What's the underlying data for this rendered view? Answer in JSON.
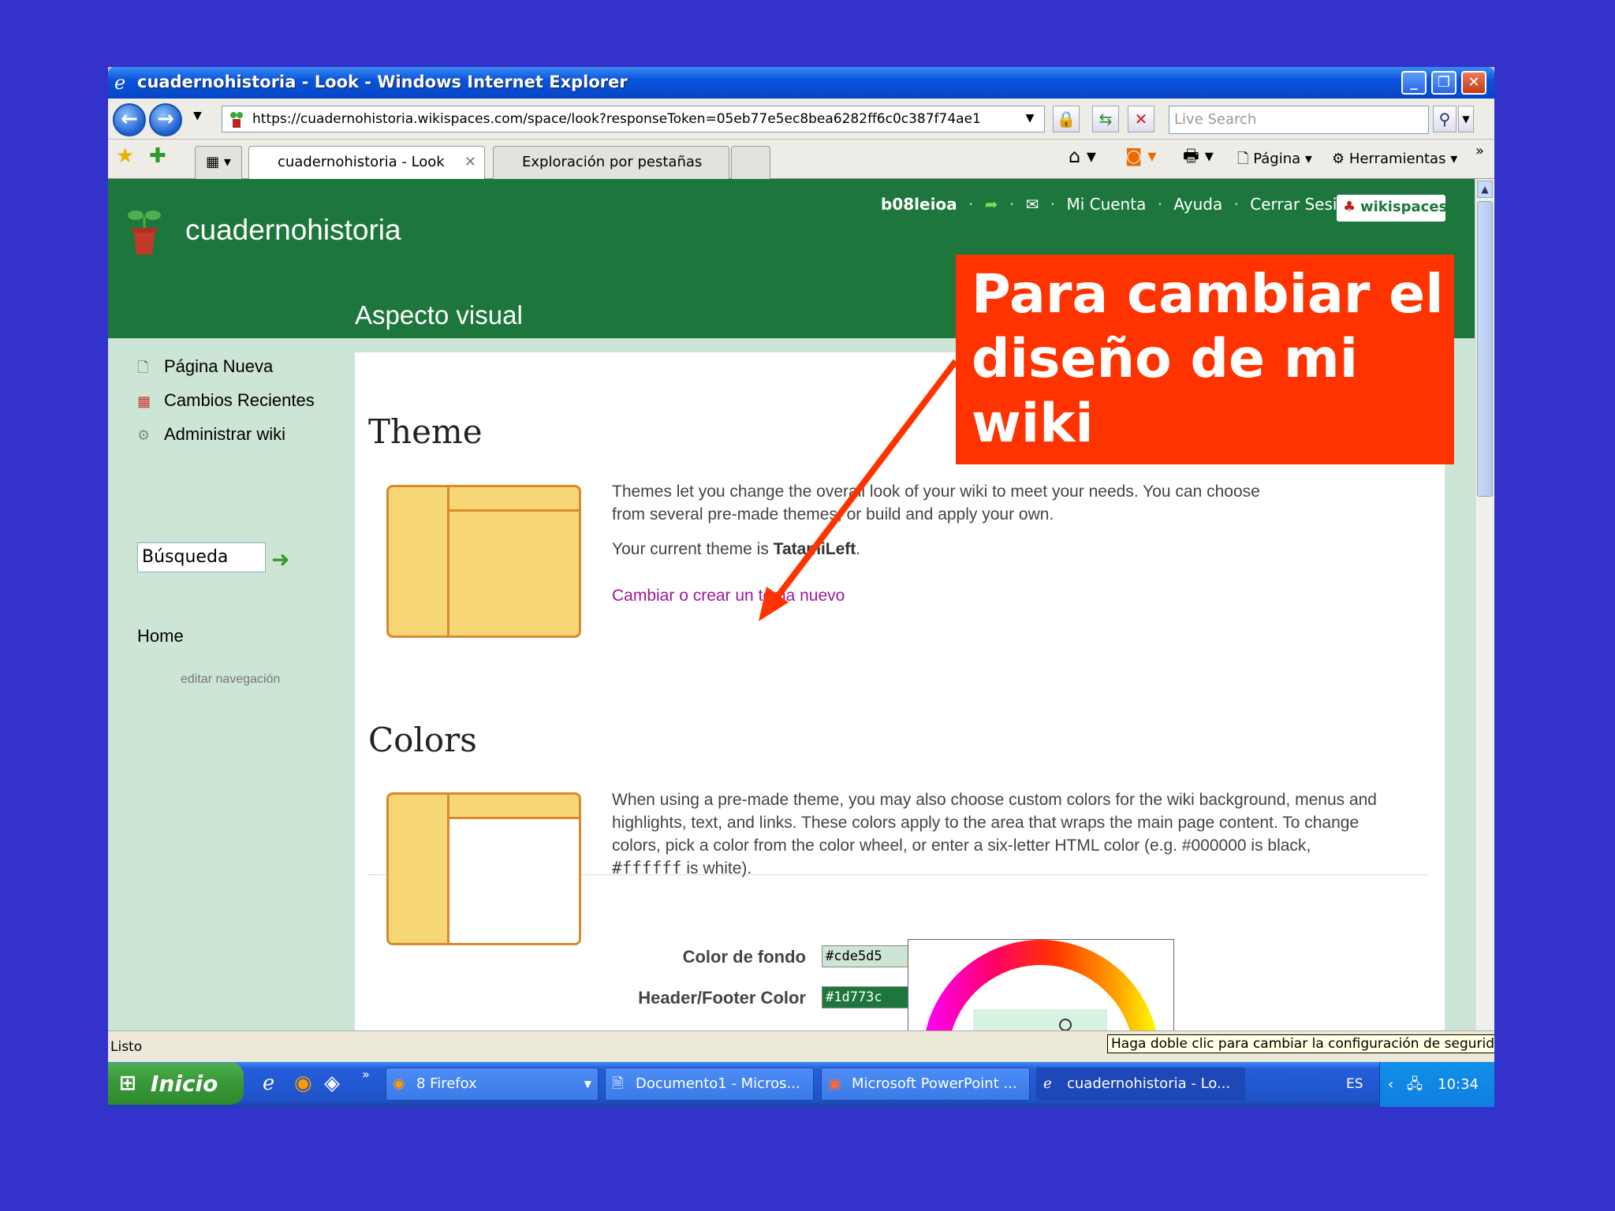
{
  "window": {
    "title": "cuadernohistoria - Look - Windows Internet Explorer",
    "buttons": {
      "minimize": "_",
      "maximize": "❐",
      "close": "✕"
    }
  },
  "address_bar": {
    "url": "https://cuadernohistoria.wikispaces.com/space/look?responseToken=05eb77e5ec8bea6282ff6c0c387f74ae1",
    "search_placeholder": "Live Search"
  },
  "tabs": [
    {
      "label": "cuadernohistoria - Look",
      "close": "✕"
    },
    {
      "label": "Exploración por pestañas"
    }
  ],
  "toolbar": {
    "page": "Página",
    "tools": "Herramientas",
    "more": "»"
  },
  "site": {
    "name": "cuadernohistoria",
    "page_title": "Aspecto visual",
    "top_links": {
      "user": "b08leioa",
      "account": "Mi Cuenta",
      "help": "Ayuda",
      "logout": "Cerrar Sesión",
      "brand": "wikispaces"
    }
  },
  "sidebar": {
    "new_page": "Página Nueva",
    "recent_changes": "Cambios Recientes",
    "manage": "Administrar wiki",
    "search_value": "Búsqueda",
    "home": "Home",
    "edit_nav": "editar navegación"
  },
  "theme": {
    "heading": "Theme",
    "desc_line1": "Themes let you change the overall look of your wiki to meet your needs. You can choose",
    "desc_line2": "from several pre-made themes, or build and apply your own.",
    "current_prefix": "Your current theme is ",
    "current_name": "TatamiLeft",
    "current_suffix": ".",
    "link": "Cambiar o crear un tema nuevo"
  },
  "colors": {
    "heading": "Colors",
    "desc_line1": "When using a pre-made theme, you may also choose custom colors for the wiki background, menus and",
    "desc_line2": "highlights, text, and links. These colors apply to the area that wraps the main page content. To change",
    "desc_line3": "colors, pick a color from the color wheel, or enter a six-letter HTML color (e.g. #000000 is black,",
    "desc_line4a": "#ffffff",
    "desc_line4b": " is white).",
    "bg_label": "Color de fondo",
    "bg_value": "#cde5d5",
    "hf_label": "Header/Footer Color",
    "hf_value": "#1d773c"
  },
  "status": {
    "text": "Listo",
    "tooltip": "Haga doble clic para cambiar la configuración de seguridad"
  },
  "taskbar": {
    "start": "Inicio",
    "items": [
      "8 Firefox",
      "Documento1 - Micros...",
      "Microsoft PowerPoint ...",
      "cuadernohistoria - Lo..."
    ],
    "lang": "ES",
    "clock": "10:34"
  },
  "callout": {
    "line1": "Para cambiar el",
    "line2": "diseño de mi",
    "line3": "wiki",
    "color": "#ff3300"
  }
}
